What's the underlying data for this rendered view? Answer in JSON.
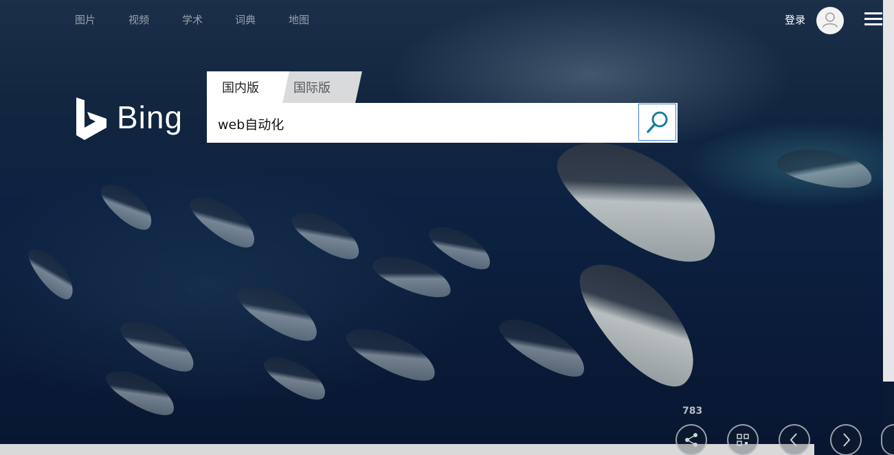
{
  "nav": {
    "links": [
      "图片",
      "视频",
      "学术",
      "词典",
      "地图"
    ],
    "login_label": "登录"
  },
  "logo": {
    "text": "Bing"
  },
  "search": {
    "tabs": [
      {
        "label": "国内版",
        "active": true
      },
      {
        "label": "国际版",
        "active": false
      }
    ],
    "query": "web自动化"
  },
  "footer": {
    "counter": "783"
  },
  "colors": {
    "accent": "#3f7fd0",
    "search_icon": "#177d9c",
    "nav_link": "#9aa3ab"
  },
  "icons": [
    "user-icon",
    "menu-icon",
    "search-icon",
    "share-icon",
    "qr-code-icon",
    "chevron-left-icon",
    "chevron-right-icon"
  ]
}
